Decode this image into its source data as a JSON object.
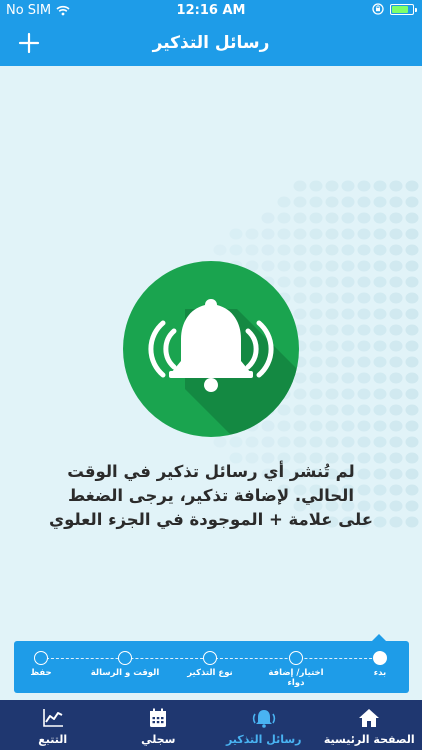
{
  "status_bar": {
    "carrier": "No SIM",
    "time": "12:16 AM",
    "battery_level": 0.8,
    "icons": [
      "wifi-icon",
      "orientation-lock-icon",
      "battery-icon"
    ]
  },
  "nav": {
    "title": "رسائل التذكير",
    "add_icon": "plus-icon"
  },
  "empty_state": {
    "icon": "bell-ringing-icon",
    "lines": [
      "لم تُنشر أي رسائل تذكير في الوقت",
      "الحالي. لإضافة تذكير، يرجى الضغط",
      "على علامة + الموجودة في الجزء العلوي"
    ]
  },
  "steps": {
    "active_index": 0,
    "items": [
      {
        "label": "بدء"
      },
      {
        "label": "اختيار/ إضافة دواء"
      },
      {
        "label": "نوع التذكير"
      },
      {
        "label": "الوقت و الرسالة"
      },
      {
        "label": "حفظ"
      }
    ]
  },
  "tabs": {
    "active_index": 1,
    "items": [
      {
        "label": "الصفحة الرئيسية",
        "icon": "home-icon"
      },
      {
        "label": "رسائل التذكير",
        "icon": "bell-icon"
      },
      {
        "label": "سجلي",
        "icon": "calendar-icon"
      },
      {
        "label": "التتبع",
        "icon": "chart-icon"
      }
    ]
  },
  "colors": {
    "primary": "#1e9ce8",
    "background": "#e1f3f8",
    "accent_green": "#1aa44f",
    "tab_bar": "#1f3770",
    "tab_active": "#49b3f2"
  }
}
